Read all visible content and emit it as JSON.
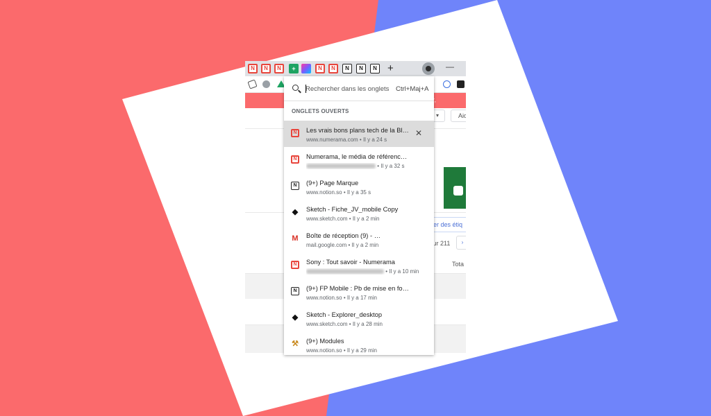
{
  "popup": {
    "search_placeholder": "Rechercher dans les onglets",
    "shortcut": "Ctrl+Maj+A",
    "section_title": "ONGLETS OUVERTS",
    "tabs": [
      {
        "title": "Les vrais bons plans tech de la Black ...",
        "url": "www.numerama.com",
        "time": "Il y a 24 s",
        "icon": "numerama-icon",
        "selected": true
      },
      {
        "title": "Numerama, le média de référence sur la s...",
        "url": "",
        "time": "Il y a 32 s",
        "icon": "numerama-icon",
        "selected": false
      },
      {
        "title": "(9+) Page Marque",
        "url": "www.notion.so",
        "time": "Il y a 35 s",
        "icon": "notion-icon",
        "selected": false
      },
      {
        "title": "Sketch - Fiche_JV_mobile Copy",
        "url": "www.sketch.com",
        "time": "Il y a 2 min",
        "icon": "sketch-icon",
        "selected": false
      },
      {
        "title": "Boîte de réception (9) -",
        "url": "mail.google.com",
        "time": "Il y a 2 min",
        "icon": "gmail-icon",
        "selected": false
      },
      {
        "title": "Sony : Tout savoir - Numerama",
        "url": "",
        "time": "Il y a 10 min",
        "icon": "numerama-icon",
        "selected": false
      },
      {
        "title": "(9+) FP Mobile : Pb de mise en forme",
        "url": "www.notion.so",
        "time": "Il y a 17 min",
        "icon": "notion-icon",
        "selected": false
      },
      {
        "title": "Sketch - Explorer_desktop",
        "url": "www.sketch.com",
        "time": "Il y a 28 min",
        "icon": "sketch-icon",
        "selected": false
      },
      {
        "title": "(9+) Modules",
        "url": "www.notion.so",
        "time": "Il y a 29 min",
        "icon": "tools-icon",
        "selected": false
      }
    ]
  },
  "tabstrip": {
    "new_tab": "+",
    "minimize": "—"
  },
  "page": {
    "labels_button": "ner des étiq",
    "pagination": "sur 211",
    "total": "Tota",
    "banner": "r,"
  },
  "colors": {
    "background_left": "#fb6a6c",
    "background_right": "#6f84fa",
    "selected_row": "#dcdcdc",
    "accent_red": "#e8453c"
  }
}
